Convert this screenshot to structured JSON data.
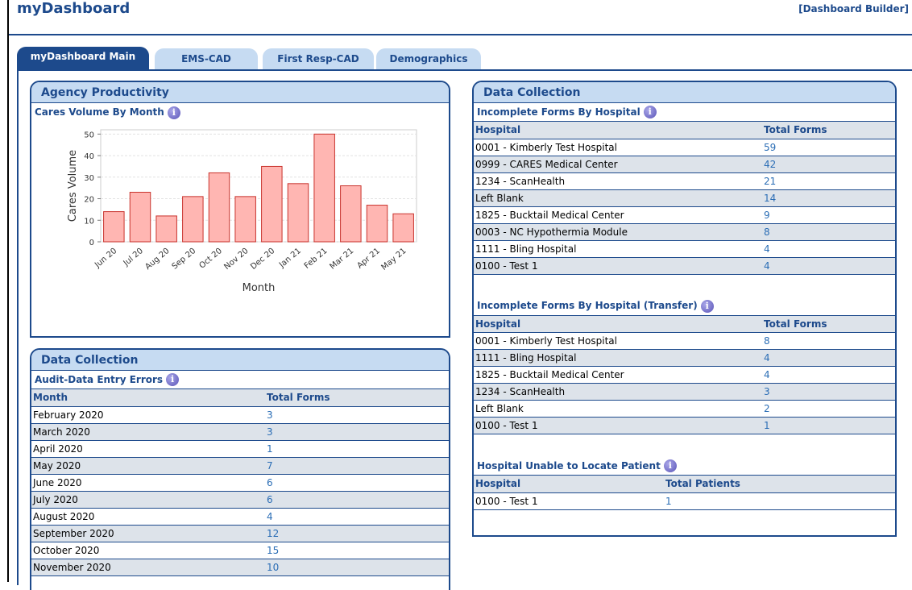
{
  "header": {
    "title": "myDashboard",
    "builder_link": "[Dashboard Builder]"
  },
  "tabs": [
    {
      "label": "myDashboard Main",
      "active": true
    },
    {
      "label": "EMS-CAD",
      "active": false
    },
    {
      "label": "First Resp-CAD",
      "active": false
    },
    {
      "label": "Demographics",
      "active": false
    }
  ],
  "agency_productivity": {
    "title": "Agency Productivity",
    "subtitle": "Cares Volume By Month",
    "info_icon": "info-icon"
  },
  "chart_data": {
    "type": "bar",
    "categories": [
      "Jun 20",
      "Jul 20",
      "Aug 20",
      "Sep 20",
      "Oct 20",
      "Nov 20",
      "Dec 20",
      "Jan 21",
      "Feb 21",
      "Mar 21",
      "Apr 21",
      "May 21"
    ],
    "values": [
      14,
      23,
      12,
      21,
      32,
      21,
      35,
      27,
      50,
      26,
      17,
      13
    ],
    "title": "Cares Volume By Month",
    "xlabel": "Month",
    "ylabel": "Cares Volume",
    "ylim": [
      0,
      52
    ],
    "yticks": [
      0,
      10,
      20,
      30,
      40,
      50
    ],
    "grid": true,
    "bar_color": "#ffb6b2",
    "bar_edge": "#c8322c"
  },
  "left_data_collection": {
    "title": "Data Collection",
    "subtitle": "Audit-Data Entry Errors",
    "columns": [
      "Month",
      "Total Forms"
    ],
    "rows": [
      [
        "February 2020",
        "3"
      ],
      [
        "March 2020",
        "3"
      ],
      [
        "April 2020",
        "1"
      ],
      [
        "May 2020",
        "7"
      ],
      [
        "June 2020",
        "6"
      ],
      [
        "July 2020",
        "6"
      ],
      [
        "August 2020",
        "4"
      ],
      [
        "September 2020",
        "12"
      ],
      [
        "October 2020",
        "15"
      ],
      [
        "November 2020",
        "10"
      ]
    ]
  },
  "right_data_collection": {
    "title": "Data Collection",
    "sections": [
      {
        "subtitle": "Incomplete Forms By Hospital",
        "columns": [
          "Hospital",
          "Total Forms"
        ],
        "rows": [
          [
            "0001 - Kimberly Test Hospital",
            "59"
          ],
          [
            "0999 - CARES Medical Center",
            "42"
          ],
          [
            "1234 - ScanHealth",
            "21"
          ],
          [
            "Left Blank",
            "14"
          ],
          [
            "1825 - Bucktail Medical Center",
            "9"
          ],
          [
            "0003 - NC Hypothermia Module",
            "8"
          ],
          [
            "1111 - Bling Hospital",
            "4"
          ],
          [
            "0100 - Test 1",
            "4"
          ]
        ]
      },
      {
        "subtitle": "Incomplete Forms By Hospital (Transfer)",
        "columns": [
          "Hospital",
          "Total Forms"
        ],
        "rows": [
          [
            "0001 - Kimberly Test Hospital",
            "8"
          ],
          [
            "1111 - Bling Hospital",
            "4"
          ],
          [
            "1825 - Bucktail Medical Center",
            "4"
          ],
          [
            "1234 - ScanHealth",
            "3"
          ],
          [
            "Left Blank",
            "2"
          ],
          [
            "0100 - Test 1",
            "1"
          ]
        ]
      },
      {
        "subtitle": "Hospital Unable to Locate Patient",
        "columns": [
          "Hospital",
          "Total Patients"
        ],
        "rows": [
          [
            "0100 - Test 1",
            "1"
          ]
        ]
      }
    ]
  },
  "colors": {
    "accent": "#1d4a8c",
    "tab_inactive": "#c6dbf2",
    "row_alt": "#dde3ea",
    "link": "#2a6db5"
  }
}
